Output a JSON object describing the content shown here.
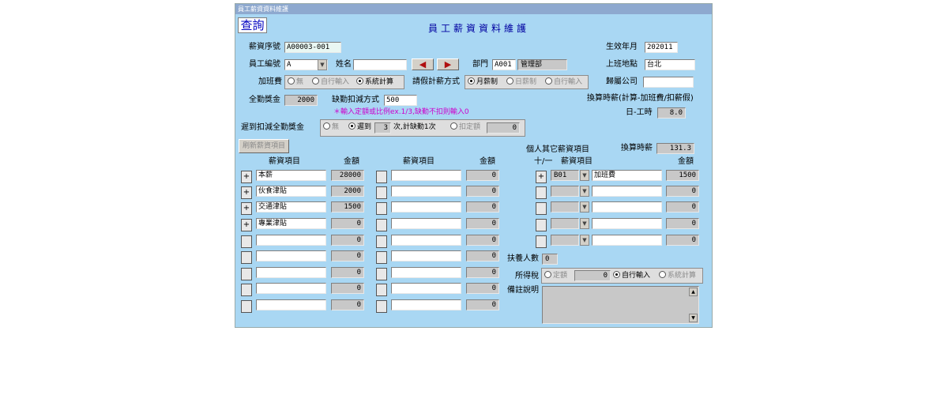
{
  "window": {
    "title": "員工薪資資料維護"
  },
  "mode_label": "查詢",
  "form_title": "員工薪資資料維護",
  "fields": {
    "salary_no": {
      "label": "薪資序號",
      "value": "A00003-001"
    },
    "effective_month": {
      "label": "生效年月",
      "value": "202011"
    },
    "emp_no": {
      "label": "員工編號",
      "value": "A"
    },
    "name": {
      "label": "姓名",
      "value": ""
    },
    "dept": {
      "label": "部門",
      "code": "A001",
      "name": "管理部"
    },
    "work_location": {
      "label": "上班地點",
      "value": "台北"
    },
    "overtime": {
      "label": "加班費",
      "options": [
        "無",
        "自行輸入",
        "系統計算"
      ],
      "selected": 2
    },
    "leave_method": {
      "label": "請假計薪方式",
      "options": [
        "月薪制",
        "日薪制",
        "自行輸入"
      ],
      "selected": 0
    },
    "company": {
      "label": "歸屬公司",
      "value": ""
    },
    "attendance_bonus": {
      "label": "全勤獎金",
      "value": "2000"
    },
    "absence_deduct": {
      "label": "缺勤扣減方式",
      "value": "500",
      "note": "＊輸入定額或比例ex.1/3,缺勤不扣則輸入0"
    },
    "hourly_conv": {
      "label": "換算時薪(計算-加班費/扣薪假)"
    },
    "daily_hours": {
      "label": "日-工時",
      "value": "8.0"
    },
    "late_deduct": {
      "label": "遲到扣減全勤獎金",
      "opt_none": "無",
      "opt_late": "遲到",
      "count": "3",
      "count_text": "次,計缺勤1次",
      "opt_fixed": "扣定額",
      "fixed_value": "0"
    },
    "hourly_wage": {
      "label": "換算時薪",
      "value": "131.3"
    },
    "dependents": {
      "label": "扶養人數",
      "value": "0"
    },
    "income_tax": {
      "label": "所得稅",
      "opt_fixed": "定額",
      "value": "0",
      "opt_manual": "自行輸入",
      "opt_system": "系統計算"
    },
    "remarks": {
      "label": "備註說明",
      "value": ""
    }
  },
  "refresh_button": "刷新薪資項目",
  "columns": {
    "item": "薪資項目",
    "amount": "金額",
    "other_title": "個人其它薪資項目",
    "plusminus": "十/一"
  },
  "left_items": [
    {
      "sign": "+",
      "name": "本薪",
      "amount": "28000"
    },
    {
      "sign": "+",
      "name": "伙食津貼",
      "amount": "2000"
    },
    {
      "sign": "+",
      "name": "交通津貼",
      "amount": "1500"
    },
    {
      "sign": "+",
      "name": "專業津貼",
      "amount": "0"
    },
    {
      "sign": "",
      "name": "",
      "amount": "0"
    },
    {
      "sign": "",
      "name": "",
      "amount": "0"
    },
    {
      "sign": "",
      "name": "",
      "amount": "0"
    },
    {
      "sign": "",
      "name": "",
      "amount": "0"
    },
    {
      "sign": "",
      "name": "",
      "amount": "0"
    }
  ],
  "mid_items": [
    {
      "sign": "",
      "name": "",
      "amount": "0"
    },
    {
      "sign": "",
      "name": "",
      "amount": "0"
    },
    {
      "sign": "",
      "name": "",
      "amount": "0"
    },
    {
      "sign": "",
      "name": "",
      "amount": "0"
    },
    {
      "sign": "",
      "name": "",
      "amount": "0"
    },
    {
      "sign": "",
      "name": "",
      "amount": "0"
    },
    {
      "sign": "",
      "name": "",
      "amount": "0"
    },
    {
      "sign": "",
      "name": "",
      "amount": "0"
    },
    {
      "sign": "",
      "name": "",
      "amount": "0"
    }
  ],
  "right_items": [
    {
      "sign": "+",
      "code": "B01",
      "name": "加班費",
      "amount": "1500"
    },
    {
      "sign": "",
      "code": "",
      "name": "",
      "amount": "0"
    },
    {
      "sign": "",
      "code": "",
      "name": "",
      "amount": "0"
    },
    {
      "sign": "",
      "code": "",
      "name": "",
      "amount": "0"
    },
    {
      "sign": "",
      "code": "",
      "name": "",
      "amount": "0"
    }
  ],
  "colors": {
    "window_bg": "#a9d7f3",
    "title_bar": "#8ea9cf",
    "title_text": "#0000a0",
    "note_text": "#cc00cc"
  }
}
